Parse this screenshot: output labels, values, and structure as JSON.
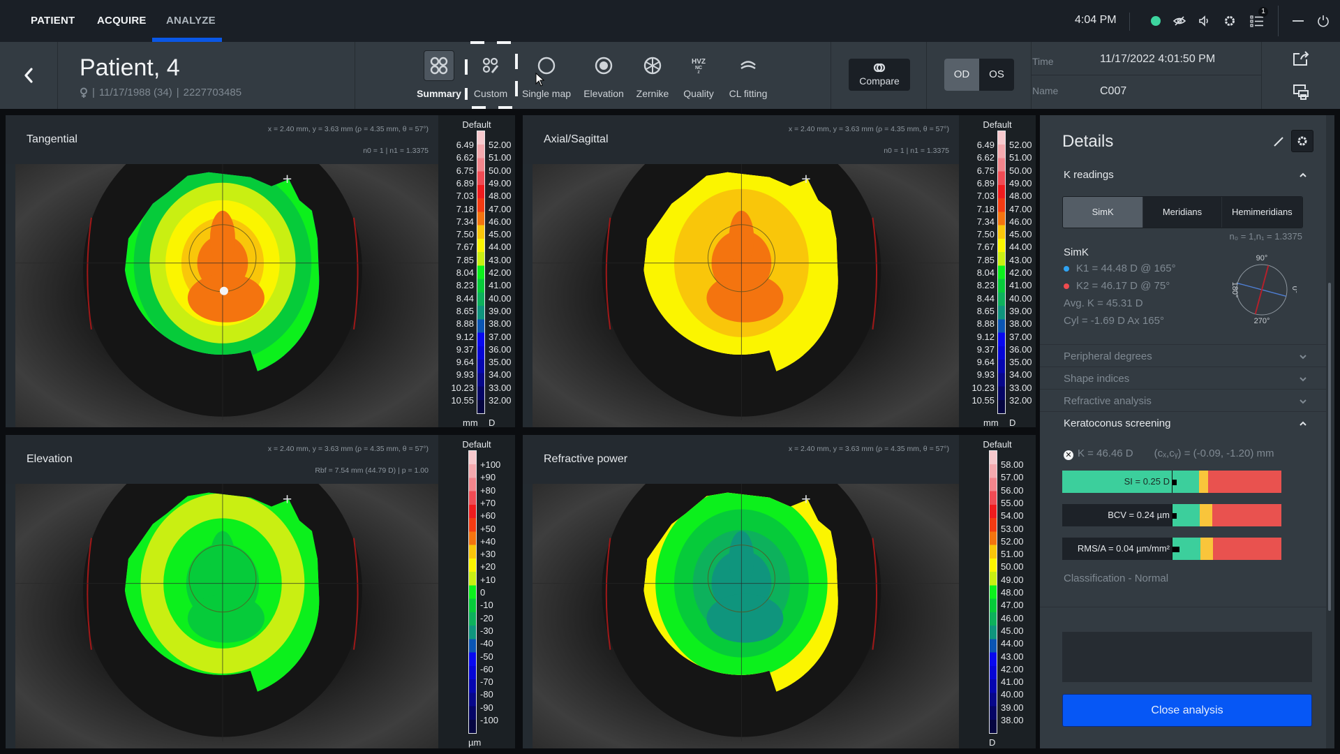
{
  "topbar": {
    "tabs": [
      {
        "label": "PATIENT",
        "active": false
      },
      {
        "label": "ACQUIRE",
        "active": false
      },
      {
        "label": "ANALYZE",
        "active": true
      }
    ],
    "time": "4:04 PM",
    "status_color": "#3dd59f",
    "icons": [
      "status-dot",
      "eye-hidden-icon",
      "volume-icon",
      "gear-icon",
      "task-list-icon",
      "minimize-icon",
      "power-icon"
    ],
    "task_badge": "1"
  },
  "patient": {
    "name": "Patient, 4",
    "gender_icon": "female-icon",
    "dob": "11/17/1988 (34)",
    "id": "2227703485"
  },
  "modes": [
    {
      "label": "Summary",
      "icon": "summary-grid-icon",
      "active": true
    },
    {
      "label": "Custom",
      "icon": "custom-grid-icon",
      "active": false
    },
    {
      "label": "Single map",
      "icon": "single-map-icon",
      "active": false
    },
    {
      "label": "Elevation",
      "icon": "elevation-icon",
      "active": false
    },
    {
      "label": "Zernike",
      "icon": "zernike-icon",
      "active": false
    },
    {
      "label": "Quality",
      "icon": "quality-icon",
      "active": false
    },
    {
      "label": "CL fitting",
      "icon": "cl-fitting-icon",
      "active": false
    }
  ],
  "compare_label": "Compare",
  "eye": {
    "od": "OD",
    "os": "OS",
    "selected": "OD"
  },
  "exam": {
    "time_label": "Time",
    "time_value": "11/17/2022 4:01:50 PM",
    "name_label": "Name",
    "name_value": "C007"
  },
  "maps": [
    {
      "title": "Tangential",
      "coord": "x = 2.40 mm, y = 3.63 mm (ρ = 4.35 mm, θ = 57°)",
      "sub": "n0 = 1  |  n1 = 1.3375",
      "legend": {
        "title": "Default",
        "left_labels": [
          "6.49",
          "6.62",
          "6.75",
          "6.89",
          "7.03",
          "7.18",
          "7.34",
          "7.50",
          "7.67",
          "7.85",
          "8.04",
          "8.23",
          "8.44",
          "8.65",
          "8.88",
          "9.12",
          "9.37",
          "9.64",
          "9.93",
          "10.23",
          "10.55"
        ],
        "right_labels": [
          "52.00",
          "51.00",
          "50.00",
          "49.00",
          "48.00",
          "47.00",
          "46.00",
          "45.00",
          "44.00",
          "43.00",
          "42.00",
          "41.00",
          "40.00",
          "39.00",
          "38.00",
          "37.00",
          "36.00",
          "35.00",
          "34.00",
          "33.00",
          "32.00"
        ],
        "unit_left": "mm",
        "unit_right": "D"
      }
    },
    {
      "title": "Axial/Sagittal",
      "coord": "x = 2.40 mm, y = 3.63 mm (ρ = 4.35 mm, θ = 57°)",
      "sub": "n0 = 1  |  n1 = 1.3375",
      "legend": {
        "title": "Default",
        "left_labels": [
          "6.49",
          "6.62",
          "6.75",
          "6.89",
          "7.03",
          "7.18",
          "7.34",
          "7.50",
          "7.67",
          "7.85",
          "8.04",
          "8.23",
          "8.44",
          "8.65",
          "8.88",
          "9.12",
          "9.37",
          "9.64",
          "9.93",
          "10.23",
          "10.55"
        ],
        "right_labels": [
          "52.00",
          "51.00",
          "50.00",
          "49.00",
          "48.00",
          "47.00",
          "46.00",
          "45.00",
          "44.00",
          "43.00",
          "42.00",
          "41.00",
          "40.00",
          "39.00",
          "38.00",
          "37.00",
          "36.00",
          "35.00",
          "34.00",
          "33.00",
          "32.00"
        ],
        "unit_left": "mm",
        "unit_right": "D"
      }
    },
    {
      "title": "Elevation",
      "coord": "x = 2.40 mm, y = 3.63 mm (ρ = 4.35 mm, θ = 57°)",
      "sub": "Rbf = 7.54 mm (44.79 D)  |  p = 1.00",
      "legend": {
        "title": "Default",
        "right_labels": [
          "+100",
          "+90",
          "+80",
          "+70",
          "+60",
          "+50",
          "+40",
          "+30",
          "+20",
          "+10",
          "0",
          "-10",
          "-20",
          "-30",
          "-40",
          "-50",
          "-60",
          "-70",
          "-80",
          "-90",
          "-100"
        ],
        "unit_right": "µm"
      }
    },
    {
      "title": "Refractive power",
      "coord": "x = 2.40 mm, y = 3.63 mm (ρ = 4.35 mm, θ = 57°)",
      "sub": "",
      "legend": {
        "title": "Default",
        "right_labels": [
          "58.00",
          "57.00",
          "56.00",
          "55.00",
          "54.00",
          "53.00",
          "52.00",
          "51.00",
          "50.00",
          "49.00",
          "48.00",
          "47.00",
          "46.00",
          "45.00",
          "44.00",
          "43.00",
          "42.00",
          "41.00",
          "40.00",
          "39.00",
          "38.00"
        ],
        "unit_right": "D"
      }
    }
  ],
  "scale_colors": [
    "#f7c9cd",
    "#f5a9ae",
    "#f2858c",
    "#f04b54",
    "#f01c1e",
    "#f43b12",
    "#f4740f",
    "#f9c60a",
    "#fbf500",
    "#c9ef12",
    "#0cf01c",
    "#06cb3a",
    "#0db15c",
    "#0f957d",
    "#0a55b4",
    "#0808f0",
    "#0505d6",
    "#0505b0",
    "#07078a",
    "#050566",
    "#050540"
  ],
  "details": {
    "title": "Details",
    "k_readings": {
      "title": "K readings",
      "tabs": [
        "SimK",
        "Meridians",
        "Hemimeridians"
      ],
      "selected": "SimK",
      "n_index": "n₀ = 1,n₁ = 1.3375",
      "simk_title": "SimK",
      "k1": "K1 = 44.48 D @ 165°",
      "k1_color": "#2fa3f2",
      "k2": "K2 = 46.17 D @ 75°",
      "k2_color": "#ef4b4f",
      "avg": "Avg. K = 45.31 D",
      "cyl": "Cyl = -1.69 D Ax 165°",
      "dial": {
        "top": "90°",
        "left": "180°",
        "right": "0°",
        "bottom": "270°",
        "k1_axis_deg": 165,
        "k2_axis_deg": 75
      }
    },
    "collapsed_sections": [
      "Peripheral degrees",
      "Shape indices",
      "Refractive analysis"
    ],
    "keratoconus": {
      "title": "Keratoconus screening",
      "k_value": "K = 46.46 D",
      "center": "(cₓ,cᵧ) = (-0.09, -1.20) mm",
      "indices": [
        {
          "label": "SI = 0.25 D",
          "value_fraction": 0.03,
          "green_to": 0.78,
          "yellow_to": 0.85
        },
        {
          "label": "BCV = 0.24 µm",
          "value_fraction": 0.05,
          "green_to": 0.7,
          "yellow_to": 0.85
        },
        {
          "label": "RMS/A = 0.04 µm/mm²",
          "value_fraction": 0.1,
          "green_to": 0.72,
          "yellow_to": 0.85
        }
      ],
      "classification": "Classification - Normal"
    },
    "close_label": "Close analysis"
  }
}
